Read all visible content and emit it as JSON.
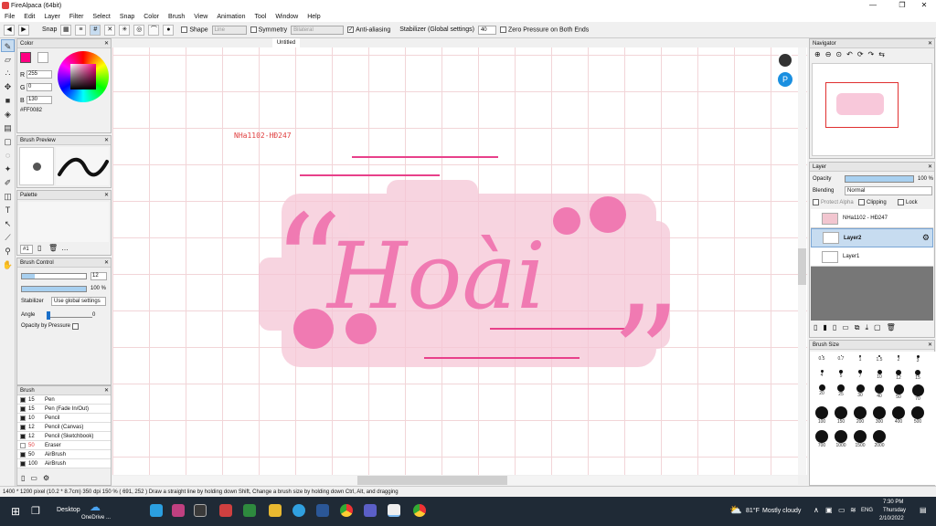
{
  "window": {
    "title": "FireAlpaca (64bit)"
  },
  "menu": [
    "File",
    "Edit",
    "Layer",
    "Filter",
    "Select",
    "Snap",
    "Color",
    "Brush",
    "View",
    "Animation",
    "Tool",
    "Window",
    "Help"
  ],
  "toolbar": {
    "snap_label": "Snap",
    "shape_label": "Shape",
    "shape_value": "Line",
    "symmetry_label": "Symmetry",
    "symmetry_value": "Bilateral",
    "antialias_label": "Anti-aliasing",
    "stabilizer_label": "Stabilizer (Global settings)",
    "stabilizer_value": "40",
    "zero_pressure_label": "Zero Pressure on Both Ends"
  },
  "color_panel": {
    "title": "Color",
    "r_label": "R",
    "r": "255",
    "g_label": "G",
    "g": "0",
    "b_label": "B",
    "b": "130",
    "hex": "#FF0082",
    "color": "#ff0082"
  },
  "brush_preview": {
    "title": "Brush Preview"
  },
  "palette": {
    "title": "Palette",
    "dropdown": "#1"
  },
  "brush_control": {
    "title": "Brush Control",
    "size": "12",
    "opacity": "100 %",
    "stabilizer_label": "Stabilizer",
    "stabilizer_value": "Use global settings",
    "angle_label": "Angle",
    "angle_value": "0",
    "opacity_pressure_label": "Opacity by Pressure"
  },
  "brush_panel": {
    "title": "Brush",
    "items": [
      {
        "size": "15",
        "name": "Pen",
        "color": "#222222"
      },
      {
        "size": "15",
        "name": "Pen (Fade In/Out)",
        "color": "#222222"
      },
      {
        "size": "10",
        "name": "Pencil",
        "color": "#222222"
      },
      {
        "size": "12",
        "name": "Pencil (Canvas)",
        "color": "#222222"
      },
      {
        "size": "12",
        "name": "Pencil (Sketchbook)",
        "color": "#222222"
      },
      {
        "size": "50",
        "name": "Eraser",
        "color": "#ffffff"
      },
      {
        "size": "50",
        "name": "AirBrush",
        "color": "#222222"
      },
      {
        "size": "100",
        "name": "AirBrush",
        "color": "#222222"
      }
    ]
  },
  "canvas": {
    "tab": "Untitled",
    "watermark": "NHa1102-HĐ247",
    "artwork_text": "Hoài",
    "open_quote": "“",
    "close_quote": "”"
  },
  "navigator": {
    "title": "Navigator"
  },
  "layer_panel": {
    "title": "Layer",
    "opacity_label": "Opacity",
    "opacity_value": "100 %",
    "blending_label": "Blending",
    "blending_value": "Normal",
    "protect_alpha": "Protect Alpha",
    "clipping": "Clipping",
    "lock": "Lock",
    "layers": [
      {
        "name": "NHa1102 - HĐ247"
      },
      {
        "name": "Layer2"
      },
      {
        "name": "Layer1"
      }
    ]
  },
  "brush_size": {
    "title": "Brush Size",
    "sizes": [
      "0.5",
      "0.7",
      "1",
      "1.5",
      "2",
      "3",
      "4",
      "5",
      "7",
      "10",
      "12",
      "15",
      "20",
      "25",
      "30",
      "40",
      "50",
      "70",
      "100",
      "150",
      "200",
      "300",
      "400",
      "500",
      "700",
      "1000",
      "1500",
      "2000"
    ]
  },
  "status": {
    "text": "1400 * 1200 pixel   (10.2 * 8.7cm)   350 dpi   150 %   ( 691, 252 )   Draw a straight line by holding down Shift, Change a brush size by holding down Ctrl, Alt, and dragging"
  },
  "taskbar": {
    "desktop": "Desktop",
    "onedrive": "OneDrive ...",
    "weather_temp": "81°F",
    "weather_desc": "Mostly cloudy",
    "lang": "ENG",
    "time": "7:30 PM",
    "day": "Thursday",
    "date": "2/10/2022"
  }
}
